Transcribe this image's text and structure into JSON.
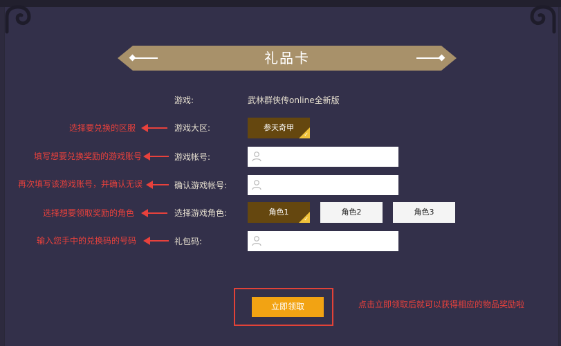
{
  "page": {
    "title": "礼品卡"
  },
  "form": {
    "game": {
      "label": "游戏:",
      "value": "武林群侠传online全新版"
    },
    "server": {
      "label": "游戏大区:",
      "option": "参天奇甲"
    },
    "account": {
      "label": "游戏帐号:",
      "value": ""
    },
    "account_confirm": {
      "label": "确认游戏帐号:",
      "value": ""
    },
    "role": {
      "label": "选择游戏角色:",
      "options": [
        "角色1",
        "角色2",
        "角色3"
      ],
      "selected": "角色1"
    },
    "gift_code": {
      "label": "礼包码:",
      "value": ""
    },
    "submit_label": "立即领取"
  },
  "annotations": {
    "server": "选择要兑换的区服",
    "account": "填写想要兑换奖励的游戏账号",
    "account_confirm": "再次填写该游戏账号，并确认无误",
    "role": "选择想要领取奖励的角色",
    "gift_code": "输入您手中的兑换码的号码",
    "submit": "点击立即领取后就可以获得相应的物品奖励啦"
  },
  "icons": {
    "check": "checkmark-icon",
    "user": "user-icon",
    "arrow": "arrow-left-icon",
    "corner": "cloud-ornament-icon"
  },
  "colors": {
    "background": "#33304a",
    "banner": "#a8916a",
    "selected_option": "#65470f",
    "check_badge": "#f0c23a",
    "submit_button": "#f2a313",
    "annotation": "#e8413c"
  }
}
